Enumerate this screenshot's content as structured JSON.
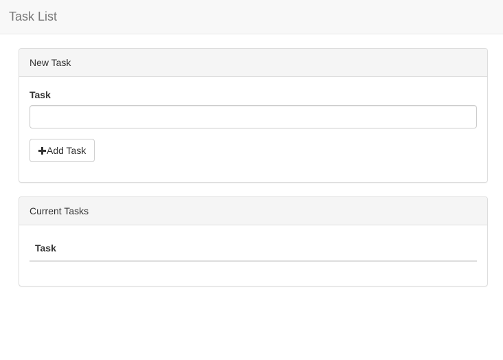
{
  "navbar": {
    "brand": "Task List"
  },
  "new_task_panel": {
    "heading": "New Task",
    "task_label": "Task",
    "task_input_value": "",
    "task_input_placeholder": "",
    "add_button_label": "Add Task",
    "add_button_icon": "plus-icon"
  },
  "current_tasks_panel": {
    "heading": "Current Tasks",
    "table": {
      "columns": [
        "Task"
      ],
      "rows": []
    }
  },
  "colors": {
    "navbar_bg": "#f8f8f8",
    "brand_text": "#777777",
    "panel_heading_bg": "#f5f5f5",
    "border": "#dddddd"
  }
}
